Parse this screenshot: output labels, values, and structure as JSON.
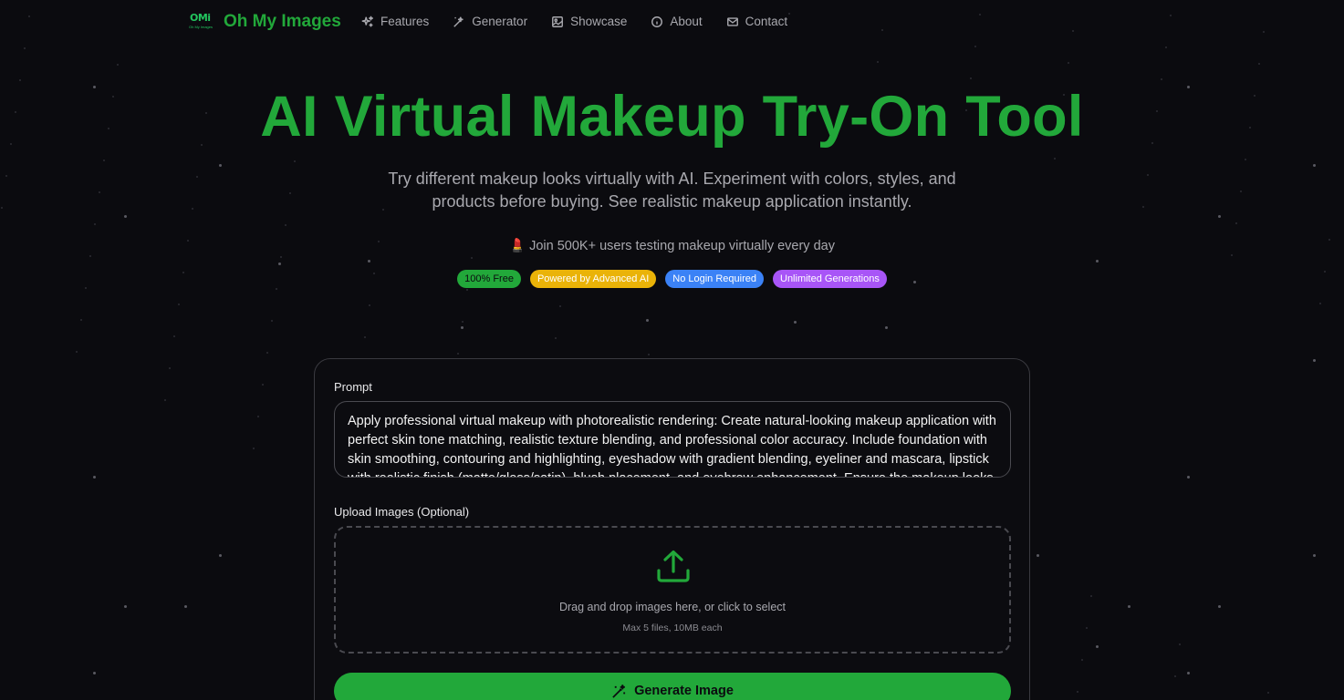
{
  "brand": {
    "logo_mark": "OMi",
    "logo_small": "Oh My Images",
    "name": "Oh My Images"
  },
  "nav": {
    "items": [
      {
        "label": "Features",
        "icon": "sparkles-icon"
      },
      {
        "label": "Generator",
        "icon": "wand-icon"
      },
      {
        "label": "Showcase",
        "icon": "image-gallery-icon"
      },
      {
        "label": "About",
        "icon": "info-icon"
      },
      {
        "label": "Contact",
        "icon": "mail-icon"
      }
    ]
  },
  "hero": {
    "title": "AI Virtual Makeup Try-On Tool",
    "subtitle": "Try different makeup looks virtually with AI. Experiment with colors, styles, and products before buying. See realistic makeup application instantly.",
    "join_emoji": "💄",
    "join_text": "Join 500K+ users testing makeup virtually every day"
  },
  "badges": [
    {
      "label": "100% Free",
      "bg": "#22a83a",
      "color": "#0b0b0f"
    },
    {
      "label": "Powered by Advanced AI",
      "bg": "#eab308",
      "color": "#ffffff"
    },
    {
      "label": "No Login Required",
      "bg": "#3b82f6",
      "color": "#ffffff"
    },
    {
      "label": "Unlimited Generations",
      "bg": "#a855f7",
      "color": "#ffffff"
    }
  ],
  "form": {
    "prompt_label": "Prompt",
    "prompt_value": "Apply professional virtual makeup with photorealistic rendering: Create natural-looking makeup application with perfect skin tone matching, realistic texture blending, and professional color accuracy. Include foundation with skin smoothing, contouring and highlighting, eyeshadow with gradient blending, eyeliner and mascara, lipstick with realistic finish (matte/gloss/satin), blush placement, and eyebrow enhancement. Ensure the makeup looks",
    "upload_label": "Upload Images (Optional)",
    "drop_text": "Drag and drop images here, or click to select",
    "drop_hint": "Max 5 files, 10MB each",
    "generate_label": "Generate Image"
  },
  "colors": {
    "accent": "#22a83a",
    "background": "#0b0b0f"
  }
}
